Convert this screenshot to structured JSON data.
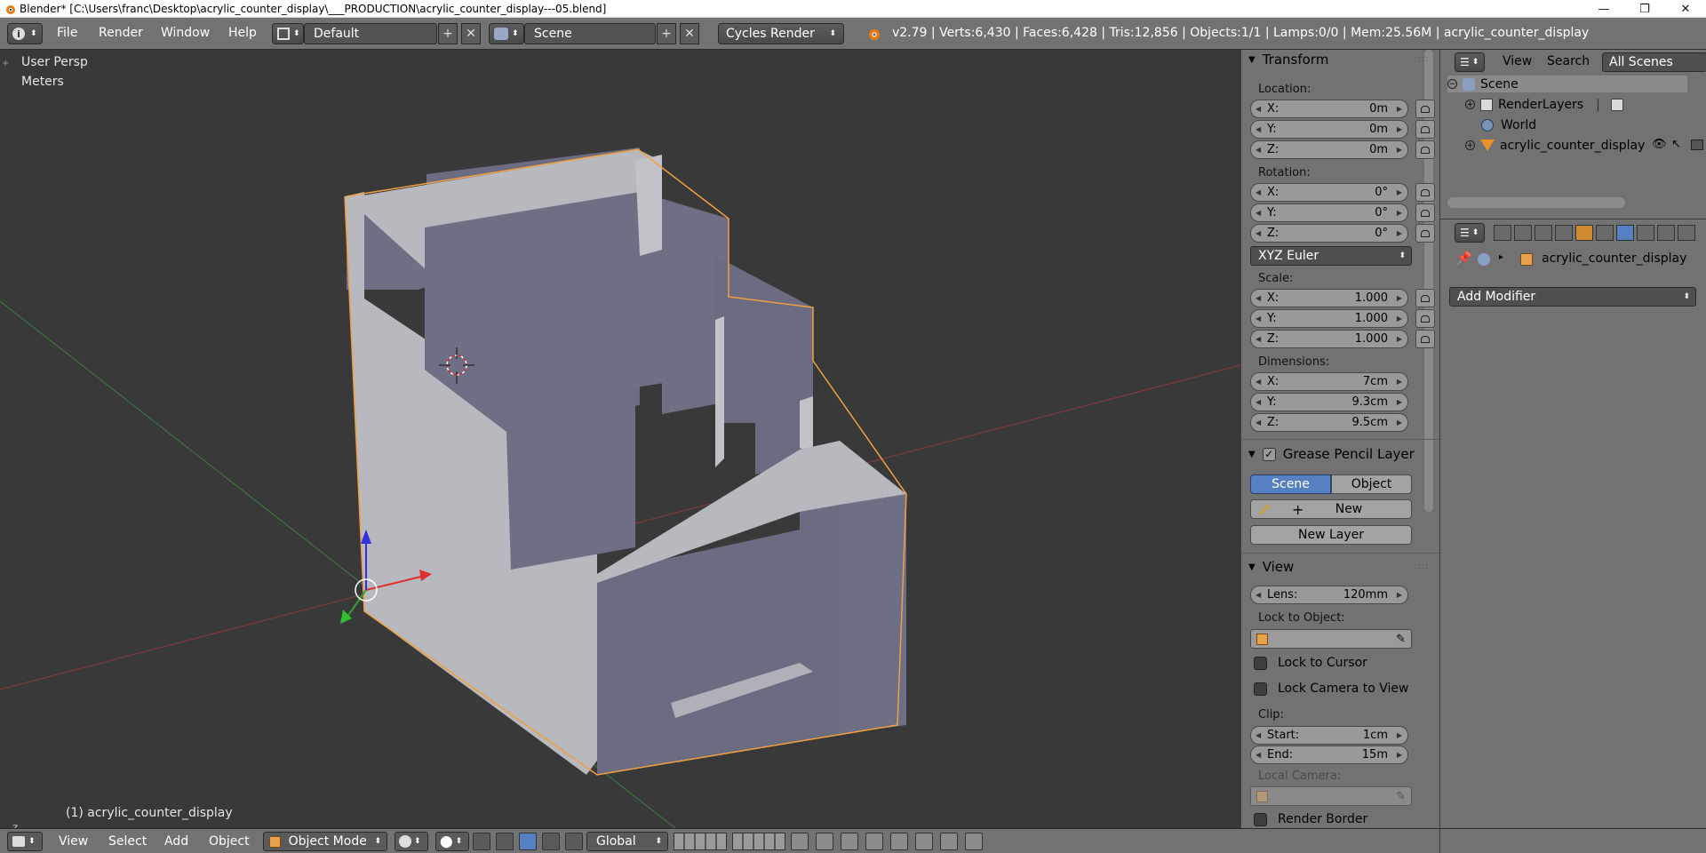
{
  "window": {
    "title": "Blender* [C:\\Users\\franc\\Desktop\\acrylic_counter_display\\___PRODUCTION\\acrylic_counter_display---05.blend]",
    "minimize": "—",
    "maximize": "❐",
    "close": "✕"
  },
  "header": {
    "menus": [
      "File",
      "Render",
      "Window",
      "Help"
    ],
    "layout": "Default",
    "scene": "Scene",
    "engine": "Cycles Render",
    "stats": "v2.79 | Verts:6,430 | Faces:6,428 | Tris:12,856 | Objects:1/1 | Lamps:0/0 | Mem:25.56M | acrylic_counter_display"
  },
  "viewport": {
    "view_name": "User Persp",
    "units": "Meters",
    "object_label": "(1) acrylic_counter_display",
    "colors": {
      "background": "#393939",
      "mesh_light": "#b7b7bd",
      "mesh_dark": "#6e6f84",
      "outline": "#f0a040"
    }
  },
  "npanel": {
    "transform": {
      "title": "Transform",
      "location_label": "Location:",
      "location": [
        {
          "axis": "X:",
          "value": "0m"
        },
        {
          "axis": "Y:",
          "value": "0m"
        },
        {
          "axis": "Z:",
          "value": "0m"
        }
      ],
      "rotation_label": "Rotation:",
      "rotation": [
        {
          "axis": "X:",
          "value": "0°"
        },
        {
          "axis": "Y:",
          "value": "0°"
        },
        {
          "axis": "Z:",
          "value": "0°"
        }
      ],
      "rotation_mode": "XYZ Euler",
      "scale_label": "Scale:",
      "scale": [
        {
          "axis": "X:",
          "value": "1.000"
        },
        {
          "axis": "Y:",
          "value": "1.000"
        },
        {
          "axis": "Z:",
          "value": "1.000"
        }
      ],
      "dimensions_label": "Dimensions:",
      "dimensions": [
        {
          "axis": "X:",
          "value": "7cm"
        },
        {
          "axis": "Y:",
          "value": "9.3cm"
        },
        {
          "axis": "Z:",
          "value": "9.5cm"
        }
      ]
    },
    "grease": {
      "title": "Grease Pencil Layer",
      "tab_scene": "Scene",
      "tab_object": "Object",
      "new": "New",
      "new_layer": "New Layer"
    },
    "view": {
      "title": "View",
      "lens_label": "Lens:",
      "lens_value": "120mm",
      "lock_to_object": "Lock to Object:",
      "lock_to_cursor": "Lock to Cursor",
      "lock_camera": "Lock Camera to View",
      "clip_label": "Clip:",
      "start_label": "Start:",
      "start_value": "1cm",
      "end_label": "End:",
      "end_value": "15m",
      "local_camera": "Local Camera:",
      "render_border": "Render Border"
    }
  },
  "outliner": {
    "view": "View",
    "search": "Search",
    "filter": "All Scenes",
    "items": [
      "Scene",
      "RenderLayers",
      "World",
      "acrylic_counter_display"
    ]
  },
  "properties": {
    "object_name": "acrylic_counter_display",
    "add_modifier": "Add Modifier"
  },
  "bottom": {
    "menus": [
      "View",
      "Select",
      "Add",
      "Object"
    ],
    "mode": "Object Mode",
    "orientation": "Global"
  }
}
